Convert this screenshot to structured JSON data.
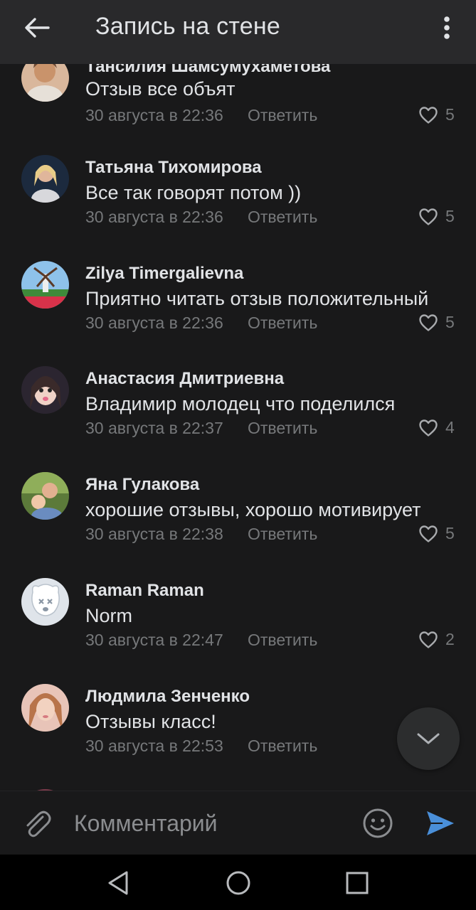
{
  "header": {
    "title": "Запись на стене",
    "back_icon": "arrow-left-icon",
    "menu_icon": "more-vertical-icon"
  },
  "comments": [
    {
      "name": "Тансилия Шамсумухаметова",
      "text": "Отзыв все объят",
      "date": "30 августа в 22:36",
      "reply": "Ответить",
      "likes": "5"
    },
    {
      "name": "Татьяна Тихомирова",
      "text": "Все так говорят потом ))",
      "date": "30 августа в 22:36",
      "reply": "Ответить",
      "likes": "5"
    },
    {
      "name": "Zilya Timergalievna",
      "text": "Приятно читать отзыв положительный",
      "date": "30 августа в 22:36",
      "reply": "Ответить",
      "likes": "5"
    },
    {
      "name": "Анастасия Дмитриевна",
      "text": "Владимир молодец что поделился",
      "date": "30 августа в 22:37",
      "reply": "Ответить",
      "likes": "4"
    },
    {
      "name": "Яна Гулакова",
      "text": "хорошие отзывы, хорошо мотивирует",
      "date": "30 августа в 22:38",
      "reply": "Ответить",
      "likes": "5"
    },
    {
      "name": "Raman Raman",
      "text": "Norm",
      "date": "30 августа в 22:47",
      "reply": "Ответить",
      "likes": "2"
    },
    {
      "name": "Людмила Зенченко",
      "text": "Отзывы класс!",
      "date": "30 августа в 22:53",
      "reply": "Ответить",
      "likes": ""
    }
  ],
  "composer": {
    "placeholder": "Комментарий",
    "attach_icon": "paperclip-icon",
    "emoji_icon": "smile-icon",
    "send_icon": "send-icon"
  },
  "scroll_down_icon": "chevron-down-icon",
  "system_nav": {
    "back_icon": "triangle-back-icon",
    "home_icon": "circle-home-icon",
    "recents_icon": "square-recents-icon"
  },
  "colors": {
    "background": "#19191a",
    "header": "#29292b",
    "text_primary": "#e1e3e6",
    "text_secondary": "#76787a",
    "accent": "#4a8fd9"
  }
}
